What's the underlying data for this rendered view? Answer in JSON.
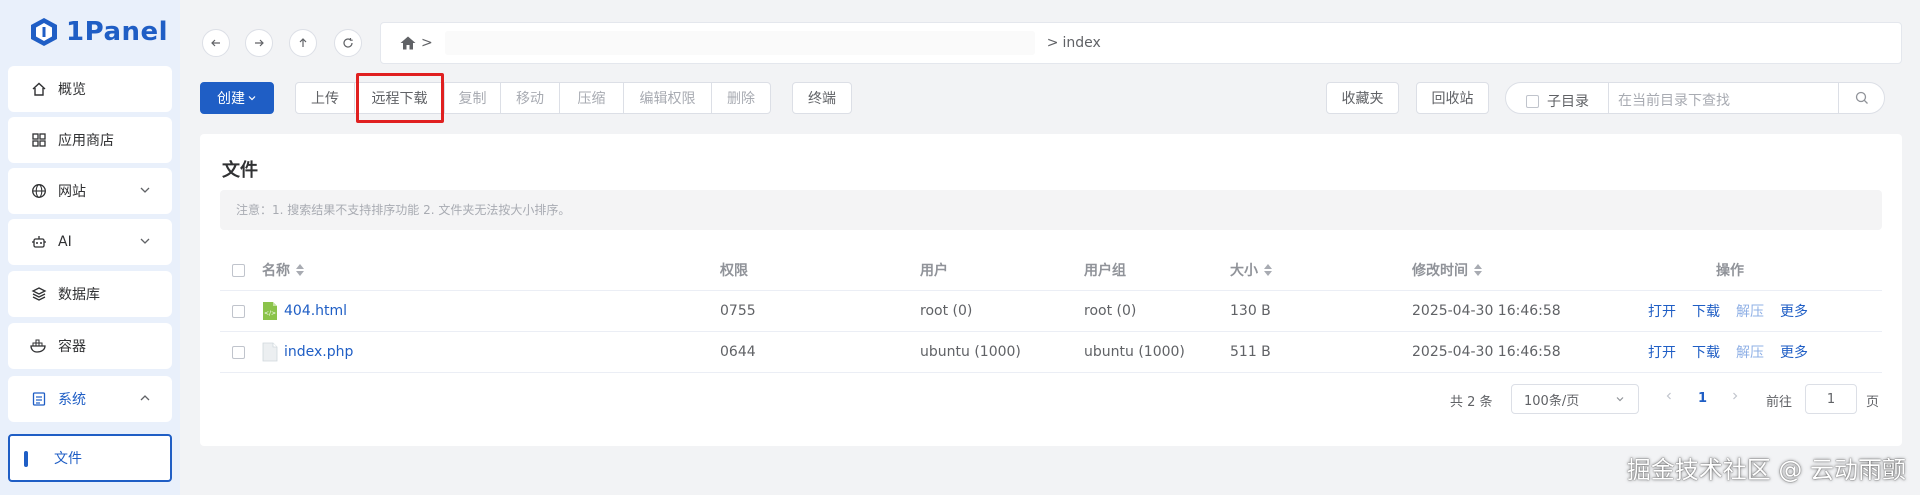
{
  "app": {
    "logo_text": "1Panel"
  },
  "sidebar": {
    "items": [
      {
        "label": "概览",
        "icon": "home-icon"
      },
      {
        "label": "应用商店",
        "icon": "apps-grid-icon"
      },
      {
        "label": "网站",
        "icon": "globe-icon",
        "expandable": true
      },
      {
        "label": "AI",
        "icon": "robot-icon",
        "expandable": true
      },
      {
        "label": "数据库",
        "icon": "database-icon"
      },
      {
        "label": "容器",
        "icon": "docker-icon"
      },
      {
        "label": "系统",
        "icon": "system-icon",
        "expandable": true,
        "expanded": true
      }
    ],
    "active_sub_item": "文件"
  },
  "path_bar": {
    "separator": ">",
    "current": "index"
  },
  "toolbar": {
    "create": "创建",
    "upload": "上传",
    "remote_download": "远程下载",
    "copy": "复制",
    "move": "移动",
    "compress": "压缩",
    "edit_perm": "编辑权限",
    "delete": "删除",
    "terminal": "终端",
    "favorites": "收藏夹",
    "recycle": "回收站",
    "subdir_label": "子目录",
    "search_placeholder": "在当前目录下查找"
  },
  "files": {
    "title": "文件",
    "notice": "注意：1. 搜索结果不支持排序功能 2. 文件夹无法按大小排序。",
    "columns": [
      "名称",
      "权限",
      "用户",
      "用户组",
      "大小",
      "修改时间",
      "操作"
    ],
    "rows": [
      {
        "name": "404.html",
        "perm": "0755",
        "user": "root (0)",
        "group": "root (0)",
        "size": "130 B",
        "mtime": "2025-04-30 16:46:58",
        "type": "html"
      },
      {
        "name": "index.php",
        "perm": "0644",
        "user": "ubuntu (1000)",
        "group": "ubuntu (1000)",
        "size": "511 B",
        "mtime": "2025-04-30 16:46:58",
        "type": "file"
      }
    ],
    "actions": {
      "open": "打开",
      "download": "下载",
      "extract": "解压",
      "more": "更多"
    }
  },
  "pagination": {
    "total_text": "共 2 条",
    "page_size": "100条/页",
    "current_page": "1",
    "goto_label": "前往",
    "goto_value": "1",
    "page_suffix": "页"
  },
  "watermark": "掘金技术社区 @ 云动雨颤",
  "colors": {
    "primary": "#1f5ec5",
    "highlight": "#e02020"
  }
}
